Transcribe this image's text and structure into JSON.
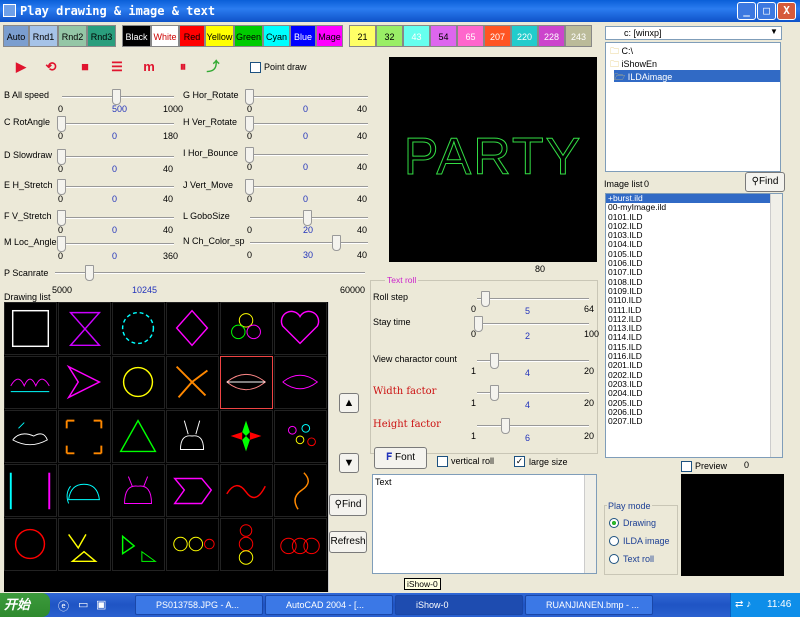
{
  "window": {
    "title": "Play drawing & image & text",
    "buttons": {
      "minimize": "_",
      "maximize": "□",
      "close": "X"
    }
  },
  "color_buttons": [
    {
      "label": "Auto",
      "bg": "#7b9ecf",
      "fg": "#000"
    },
    {
      "label": "Rnd1",
      "bg": "#a6c3e8",
      "fg": "#000"
    },
    {
      "label": "Rnd2",
      "bg": "#94c6a6",
      "fg": "#000"
    },
    {
      "label": "Rnd3",
      "bg": "#2a9e7d",
      "fg": "#000"
    },
    {
      "label": "Black",
      "bg": "#000000",
      "fg": "#ffffff"
    },
    {
      "label": "White",
      "bg": "#ffffff",
      "fg": "#cc0000"
    },
    {
      "label": "Red",
      "bg": "#ff0000",
      "fg": "#000"
    },
    {
      "label": "Yellow",
      "bg": "#ffff00",
      "fg": "#000"
    },
    {
      "label": "Green",
      "bg": "#00cc00",
      "fg": "#000"
    },
    {
      "label": "Cyan",
      "bg": "#00ffff",
      "fg": "#000"
    },
    {
      "label": "Blue",
      "bg": "#0000ff",
      "fg": "#fff"
    },
    {
      "label": "Mage",
      "bg": "#ff00ff",
      "fg": "#000"
    },
    {
      "label": "21",
      "bg": "#ffff66",
      "fg": "#000"
    },
    {
      "label": "32",
      "bg": "#99ee66",
      "fg": "#000"
    },
    {
      "label": "43",
      "bg": "#66ffee",
      "fg": "#fff"
    },
    {
      "label": "54",
      "bg": "#dd66ee",
      "fg": "#000"
    },
    {
      "label": "65",
      "bg": "#ff66cc",
      "fg": "#fff"
    },
    {
      "label": "207",
      "bg": "#ff5522",
      "fg": "#fff"
    },
    {
      "label": "220",
      "bg": "#22cccc",
      "fg": "#fff"
    },
    {
      "label": "228",
      "bg": "#cc44cc",
      "fg": "#fff"
    },
    {
      "label": "243",
      "bg": "#bbbb99",
      "fg": "#fff"
    }
  ],
  "toolbar": {
    "point_draw_label": "Point draw",
    "icons": [
      "play-icon",
      "loop-icon",
      "stop-icon",
      "sequence-icon",
      "multi-icon",
      "pause-icon",
      "path-icon"
    ]
  },
  "sliders_left": [
    {
      "label": "B All speed",
      "min": "0",
      "val": "500",
      "max": "1000",
      "pos": 0.5
    },
    {
      "label": "C RotAngle",
      "min": "0",
      "val": "0",
      "max": "180",
      "pos": 0.0
    },
    {
      "label": "D Slowdraw",
      "min": "0",
      "val": "0",
      "max": "40",
      "pos": 0.0
    },
    {
      "label": "E H_Stretch",
      "min": "0",
      "val": "0",
      "max": "40",
      "pos": 0.0
    },
    {
      "label": "F V_Stretch",
      "min": "0",
      "val": "0",
      "max": "40",
      "pos": 0.0
    },
    {
      "label": "M Loc_Angle",
      "min": "0",
      "val": "0",
      "max": "360",
      "pos": 0.0
    }
  ],
  "sliders_right": [
    {
      "label": "G Hor_Rotate",
      "min": "0",
      "val": "0",
      "max": "40",
      "pos": 0.0
    },
    {
      "label": "H Ver_Rotate",
      "min": "0",
      "val": "0",
      "max": "40",
      "pos": 0.0
    },
    {
      "label": "I Hor_Bounce",
      "min": "0",
      "val": "0",
      "max": "40",
      "pos": 0.0
    },
    {
      "label": "J Vert_Move",
      "min": "0",
      "val": "0",
      "max": "40",
      "pos": 0.0
    },
    {
      "label": "L GoboSize",
      "min": "0",
      "val": "20",
      "max": "40",
      "pos": 0.5
    },
    {
      "label": "N Ch_Color_sp",
      "min": "0",
      "val": "30",
      "max": "40",
      "pos": 0.75
    }
  ],
  "scanrate": {
    "label": "P Scanrate",
    "min": "5000",
    "val": "10245",
    "max": "60000",
    "pos": 0.1
  },
  "preview": {
    "text": "PARTY",
    "below": "80"
  },
  "drawing_list_label": "Drawing list",
  "find_label": "Find",
  "refresh_label": "Refresh",
  "text_roll": {
    "title": "Text roll",
    "sliders": [
      {
        "label": "Roll step",
        "min": "0",
        "val": "5",
        "max": "64",
        "pos": 0.08,
        "red": false
      },
      {
        "label": "Stay time",
        "min": "0",
        "val": "2",
        "max": "100",
        "pos": 0.02,
        "red": false
      },
      {
        "label": "View charactor count",
        "min": "1",
        "val": "4",
        "max": "20",
        "pos": 0.16,
        "red": false
      },
      {
        "label": "Width factor",
        "min": "1",
        "val": "4",
        "max": "20",
        "pos": 0.16,
        "red": true
      },
      {
        "label": "Height factor",
        "min": "1",
        "val": "6",
        "max": "20",
        "pos": 0.26,
        "red": true
      }
    ],
    "font_label": "Font",
    "vertical_roll": "vertical roll",
    "large_size": "large size",
    "text_value": "Text"
  },
  "tooltip": "iShow-0",
  "right": {
    "drive": "c: [winxp]",
    "tree": [
      "C:\\",
      "iShowEn",
      "ILDAimage"
    ],
    "image_list_label": "Image list",
    "image_count": "0",
    "find_label": "Find",
    "files": [
      "+burst.ild",
      "00-myImage.ild",
      "0101.ILD",
      "0102.ILD",
      "0103.ILD",
      "0104.ILD",
      "0105.ILD",
      "0106.ILD",
      "0107.ILD",
      "0108.ILD",
      "0109.ILD",
      "0110.ILD",
      "0111.ILD",
      "0112.ILD",
      "0113.ILD",
      "0114.ILD",
      "0115.ILD",
      "0116.ILD",
      "0201.ILD",
      "0202.ILD",
      "0203.ILD",
      "0204.ILD",
      "0205.ILD",
      "0206.ILD",
      "0207.ILD"
    ],
    "preview_label": "Preview",
    "preview_count": "0",
    "play_mode": {
      "title": "Play mode",
      "options": [
        "Drawing",
        "ILDA image",
        "Text roll"
      ]
    }
  },
  "taskbar": {
    "start": "开始",
    "tasks": [
      "PS013758.JPG - A...",
      "AutoCAD 2004 - [...",
      "iShow-0",
      "RUANJIANEN.bmp - ..."
    ],
    "clock": "11:46"
  }
}
